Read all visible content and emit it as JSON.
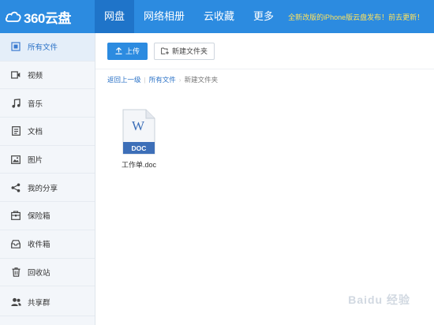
{
  "header": {
    "logo_text": "360云盘",
    "nav": [
      {
        "label": "网盘",
        "active": true
      },
      {
        "label": "网络相册",
        "active": false
      },
      {
        "label": "云收藏",
        "active": false
      },
      {
        "label": "更多",
        "active": false
      }
    ],
    "notice": "全新改版的iPhone版云盘发布！前去更新！"
  },
  "sidebar": {
    "items": [
      {
        "label": "所有文件",
        "icon": "all-files-icon",
        "active": true
      },
      {
        "label": "视频",
        "icon": "video-icon"
      },
      {
        "label": "音乐",
        "icon": "music-icon"
      },
      {
        "label": "文档",
        "icon": "document-icon"
      },
      {
        "label": "图片",
        "icon": "image-icon"
      },
      {
        "label": "我的分享",
        "icon": "share-icon"
      },
      {
        "label": "保险箱",
        "icon": "safe-icon"
      },
      {
        "label": "收件箱",
        "icon": "inbox-icon"
      },
      {
        "label": "回收站",
        "icon": "trash-icon"
      },
      {
        "label": "共享群",
        "icon": "group-icon"
      }
    ]
  },
  "toolbar": {
    "upload_label": "上传",
    "new_folder_label": "新建文件夹"
  },
  "breadcrumb": {
    "back": "返回上一级",
    "all_files": "所有文件",
    "current": "新建文件夹"
  },
  "files": [
    {
      "name": "工作单.doc",
      "type_label": "DOC",
      "glyph": "W"
    }
  ],
  "watermark": "Baidu 经验",
  "colors": {
    "brand_blue": "#2c8be0",
    "nav_active": "#1f74c9",
    "notice_yellow": "#ffe25c",
    "doc_blue": "#3d6fb8"
  }
}
